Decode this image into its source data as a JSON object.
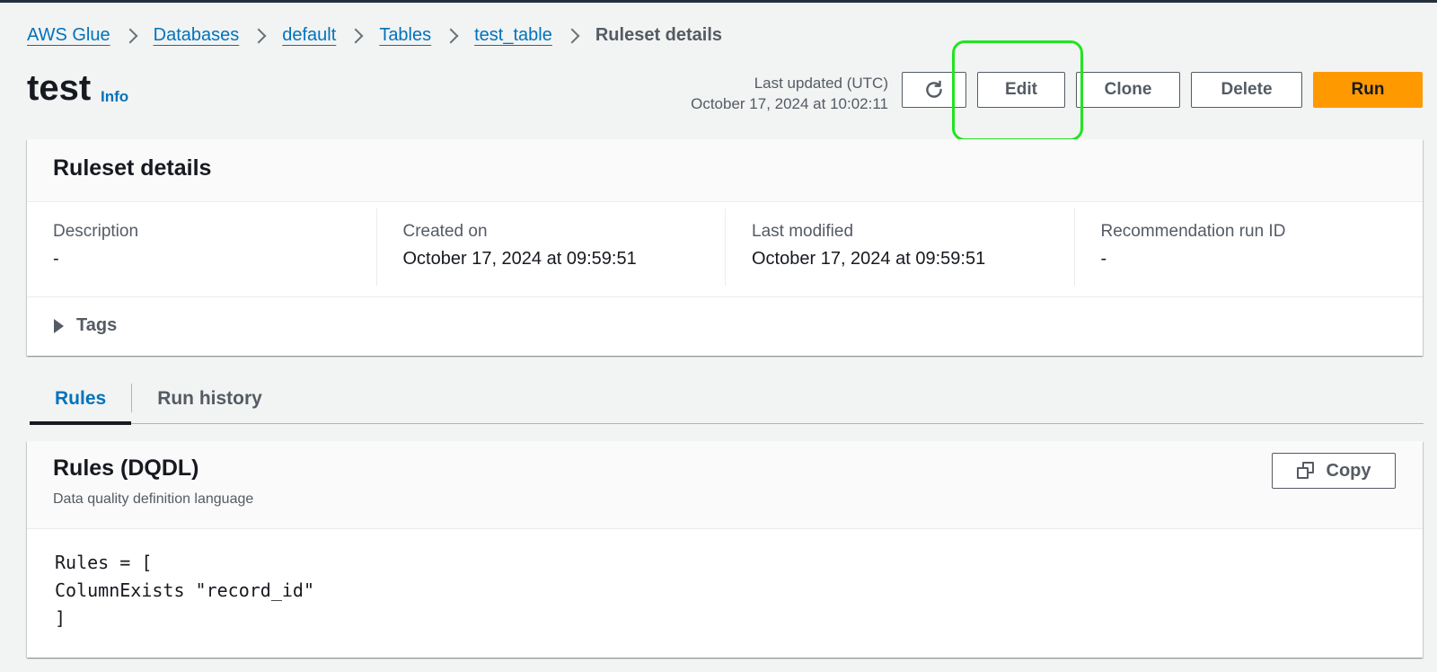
{
  "breadcrumb": {
    "items": [
      {
        "label": "AWS Glue",
        "link": true
      },
      {
        "label": "Databases",
        "link": true
      },
      {
        "label": "default",
        "link": true
      },
      {
        "label": "Tables",
        "link": true
      },
      {
        "label": "test_table",
        "link": true
      },
      {
        "label": "Ruleset details",
        "link": false
      }
    ]
  },
  "header": {
    "title": "test",
    "info_label": "Info",
    "last_updated_label": "Last updated (UTC)",
    "last_updated_value": "October 17, 2024 at 10:02:11",
    "buttons": {
      "refresh_icon": "refresh-icon",
      "edit": "Edit",
      "clone": "Clone",
      "delete": "Delete",
      "run": "Run"
    },
    "highlighted_button": "Edit"
  },
  "details": {
    "title": "Ruleset details",
    "fields": [
      {
        "label": "Description",
        "value": "-"
      },
      {
        "label": "Created on",
        "value": "October 17, 2024 at 09:59:51"
      },
      {
        "label": "Last modified",
        "value": "October 17, 2024 at 09:59:51"
      },
      {
        "label": "Recommendation run ID",
        "value": "-"
      }
    ],
    "tags_label": "Tags",
    "tags_expanded": false
  },
  "tabs": {
    "items": [
      {
        "label": "Rules",
        "active": true
      },
      {
        "label": "Run history",
        "active": false
      }
    ]
  },
  "rules": {
    "title": "Rules (DQDL)",
    "description": "Data quality definition language",
    "copy_label": "Copy",
    "code_lines": [
      "Rules = [",
      "ColumnExists \"record_id\"",
      "]"
    ]
  },
  "colors": {
    "accent_link": "#0073bb",
    "primary_button": "#ff9900",
    "highlight": "#22e322",
    "background": "#f2f3f3"
  }
}
